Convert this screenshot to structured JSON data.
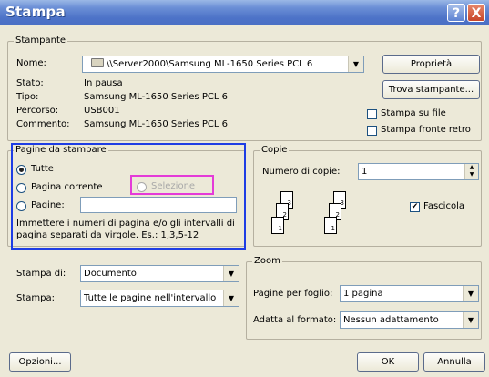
{
  "window": {
    "title": "Stampa",
    "help_label": "?",
    "close_label": "X"
  },
  "printer": {
    "group_label": "Stampante",
    "name_label": "Nome:",
    "name_value": "\\\\Server2000\\Samsung ML-1650 Series PCL 6",
    "properties_button": "Proprietà",
    "status_label": "Stato:",
    "status_value": "In pausa",
    "type_label": "Tipo:",
    "type_value": "Samsung ML-1650 Series PCL 6",
    "path_label": "Percorso:",
    "path_value": "USB001",
    "comment_label": "Commento:",
    "comment_value": "Samsung ML-1650 Series PCL 6",
    "find_printer_button": "Trova stampante...",
    "print_to_file": "Stampa su file",
    "duplex": "Stampa fronte retro"
  },
  "pages": {
    "group_label": "Pagine da stampare",
    "all": "Tutte",
    "current": "Pagina corrente",
    "selection": "Selezione",
    "pages": "Pagine:",
    "hint": "Immettere i numeri di pagina e/o gli intervalli di pagina separati da virgole. Es.: 1,3,5-12"
  },
  "copies": {
    "group_label": "Copie",
    "count_label": "Numero di copie:",
    "count_value": "1",
    "collate": "Fascicola",
    "page_numbers": [
      "1",
      "2",
      "3",
      "1",
      "2",
      "3"
    ]
  },
  "print_what": {
    "label": "Stampa di:",
    "value": "Documento"
  },
  "print_range": {
    "label": "Stampa:",
    "value": "Tutte le pagine nell'intervallo"
  },
  "zoom": {
    "group_label": "Zoom",
    "pages_per_sheet_label": "Pagine per foglio:",
    "pages_per_sheet_value": "1 pagina",
    "scale_label": "Adatta al formato:",
    "scale_value": "Nessun adattamento"
  },
  "buttons": {
    "options": "Opzioni...",
    "ok": "OK",
    "cancel": "Annulla"
  },
  "icons": {
    "dropdown": "▼",
    "spin_up": "▲",
    "spin_down": "▼",
    "check": "✔"
  }
}
